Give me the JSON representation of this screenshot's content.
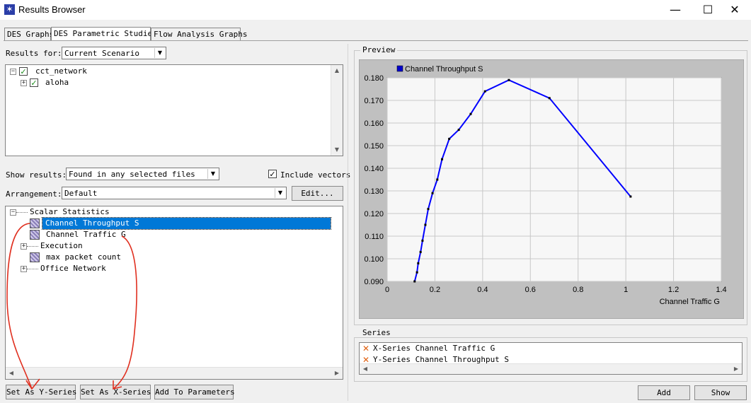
{
  "window": {
    "title": "Results Browser",
    "app_icon": "app-star-icon",
    "buttons": {
      "minimize": "—",
      "maximize": "☐",
      "close": "✕"
    }
  },
  "tabs": [
    {
      "label": "DES Graphs",
      "active": false
    },
    {
      "label": "DES Parametric Studies",
      "active": true
    },
    {
      "label": "Flow Analysis Graphs",
      "active": false
    }
  ],
  "results_for": {
    "label": "Results for:",
    "value": "Current Scenario"
  },
  "file_tree": [
    {
      "label": "cct_network",
      "checked": true
    },
    {
      "label": "aloha",
      "checked": true
    }
  ],
  "show_results": {
    "label": "Show results:",
    "value": "Found in any selected files"
  },
  "include_vectors": {
    "label": "Include vectors",
    "checked": true
  },
  "arrangement": {
    "label": "Arrangement:",
    "value": "Default",
    "edit_label": "Edit..."
  },
  "stats_tree": [
    {
      "label": "Scalar Statistics",
      "type": "folder"
    },
    {
      "label": "Channel Throughput S",
      "type": "stat",
      "selected": true
    },
    {
      "label": "Channel Traffic G",
      "type": "stat"
    },
    {
      "label": "Execution",
      "type": "folder"
    },
    {
      "label": "max packet count",
      "type": "stat"
    },
    {
      "label": "Office Network",
      "type": "folder"
    }
  ],
  "bottom_buttons": {
    "set_y": "Set As Y-Series",
    "set_x": "Set As X-Series",
    "add_params": "Add To Parameters",
    "add": "Add",
    "show": "Show"
  },
  "preview": {
    "label": "Preview"
  },
  "series_group": {
    "label": "Series",
    "items": [
      "X-Series Channel Traffic G",
      "Y-Series Channel Throughput S"
    ]
  },
  "annotation_color": "#e03020",
  "chart_data": {
    "type": "line",
    "legend": "Channel Throughput S",
    "xlabel": "Channel Traffic G",
    "ylabel": "",
    "xlim": [
      0,
      1.4
    ],
    "ylim": [
      0.09,
      0.18
    ],
    "x_ticks": [
      "0",
      "0.2",
      "0.4",
      "0.6",
      "0.8",
      "1",
      "1.2",
      "1.4"
    ],
    "y_ticks": [
      "0.090",
      "0.100",
      "0.110",
      "0.120",
      "0.130",
      "0.140",
      "0.150",
      "0.160",
      "0.170",
      "0.180"
    ],
    "line_color": "#0000ff",
    "series": [
      {
        "name": "Channel Throughput S",
        "points": [
          [
            0.115,
            0.09
          ],
          [
            0.125,
            0.094
          ],
          [
            0.13,
            0.098
          ],
          [
            0.14,
            0.103
          ],
          [
            0.148,
            0.108
          ],
          [
            0.16,
            0.115
          ],
          [
            0.172,
            0.122
          ],
          [
            0.19,
            0.129
          ],
          [
            0.21,
            0.135
          ],
          [
            0.23,
            0.144
          ],
          [
            0.26,
            0.153
          ],
          [
            0.3,
            0.157
          ],
          [
            0.35,
            0.164
          ],
          [
            0.41,
            0.174
          ],
          [
            0.51,
            0.179
          ],
          [
            0.68,
            0.171
          ],
          [
            1.02,
            0.1275
          ]
        ]
      }
    ]
  }
}
